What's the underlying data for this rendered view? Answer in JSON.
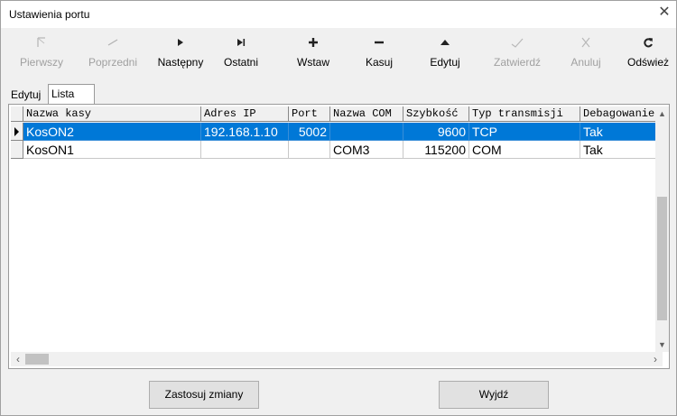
{
  "window": {
    "title": "Ustawienia portu",
    "close_glyph": "✕"
  },
  "toolbar": {
    "buttons": [
      {
        "label": "Pierwszy",
        "icon": "first-record-icon",
        "enabled": false
      },
      {
        "label": "Poprzedni",
        "icon": "prior-record-icon",
        "enabled": false
      },
      {
        "label": "Następny",
        "icon": "next-record-icon",
        "enabled": true
      },
      {
        "label": "Ostatni",
        "icon": "last-record-icon",
        "enabled": true
      },
      {
        "label": "Wstaw",
        "icon": "insert-icon",
        "enabled": true
      },
      {
        "label": "Kasuj",
        "icon": "delete-icon",
        "enabled": true
      },
      {
        "label": "Edytuj",
        "icon": "edit-icon",
        "enabled": true
      },
      {
        "label": "Zatwierdź",
        "icon": "post-icon",
        "enabled": false
      },
      {
        "label": "Anuluj",
        "icon": "cancel-icon",
        "enabled": false
      },
      {
        "label": "Odśwież",
        "icon": "refresh-icon",
        "enabled": true
      }
    ]
  },
  "tabs": [
    {
      "label": "Edytuj",
      "active": false
    },
    {
      "label": "Lista",
      "active": true
    }
  ],
  "grid": {
    "columns": [
      "Nazwa kasy",
      "Adres IP",
      "Port",
      "Nazwa COM",
      "Szybkość",
      "Typ transmisji",
      "Debagowanie"
    ],
    "rows": [
      {
        "selected": true,
        "cells": [
          "KosON2",
          "192.168.1.10",
          "5002",
          "",
          "9600",
          "TCP",
          "Tak"
        ]
      },
      {
        "selected": false,
        "cells": [
          "KosON1",
          "",
          "",
          "COM3",
          "115200",
          "COM",
          "Tak"
        ]
      }
    ]
  },
  "buttons": {
    "apply": "Zastosuj zmiany",
    "exit": "Wyjdź"
  },
  "colors": {
    "selection": "#0078d7",
    "disabled_text": "#a0a0a0"
  }
}
